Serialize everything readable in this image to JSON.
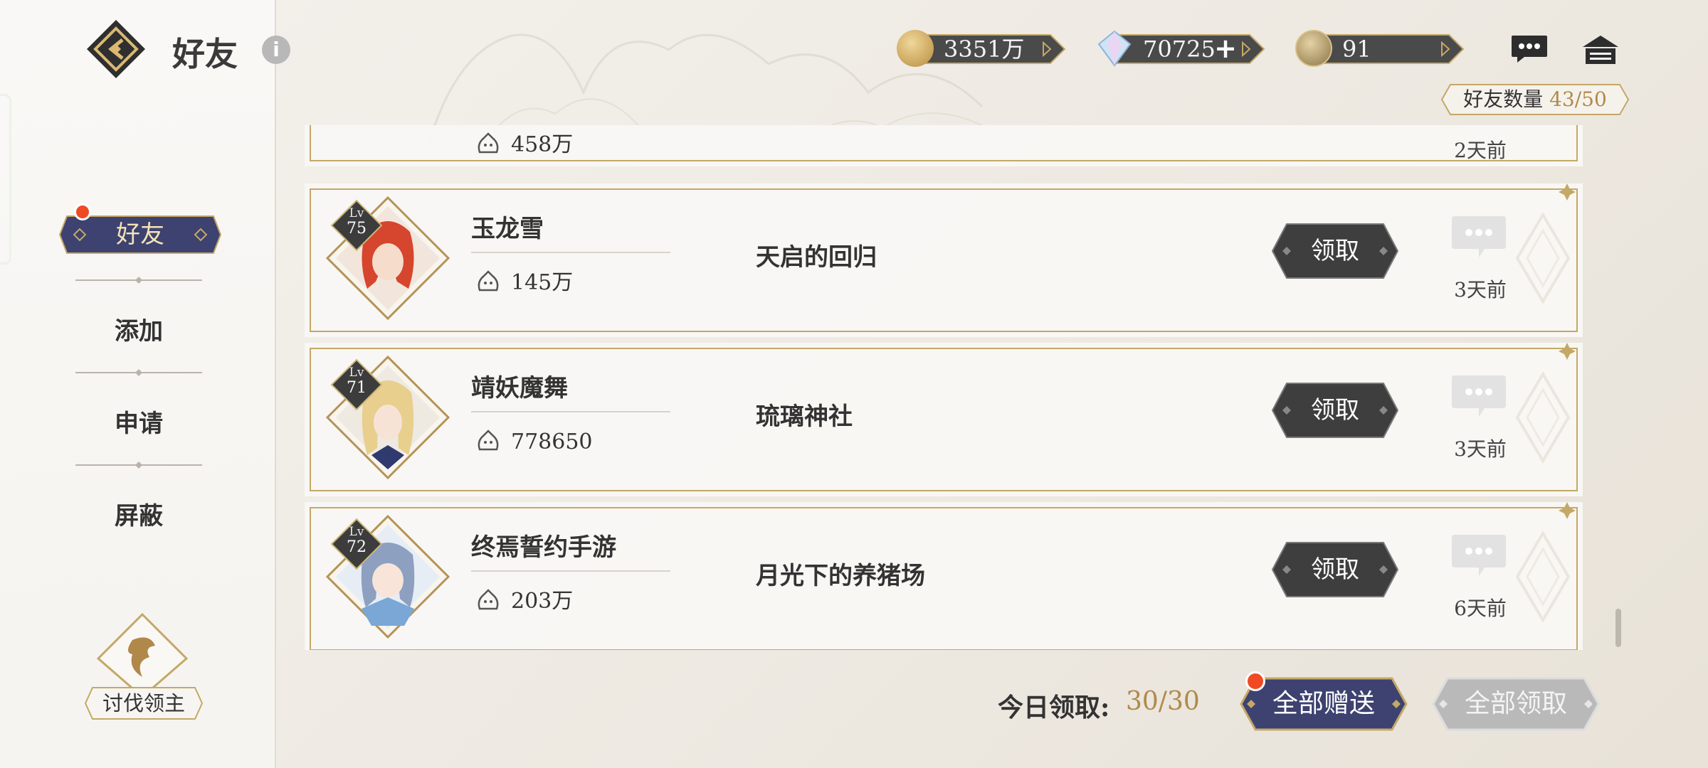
{
  "header": {
    "title": "好友",
    "info_icon": "i"
  },
  "currencies": [
    {
      "icon": "gold-coin-icon",
      "value": "3351万"
    },
    {
      "icon": "crystal-gem-icon",
      "value": "70725",
      "plus": "+"
    },
    {
      "icon": "stamina-badge-icon",
      "value": "91"
    }
  ],
  "friend_count": {
    "label": "好友数量",
    "value": "43/50"
  },
  "sidebar": {
    "items": [
      {
        "label": "好友",
        "active": true
      },
      {
        "label": "添加"
      },
      {
        "label": "申请"
      },
      {
        "label": "屏蔽"
      }
    ],
    "boss": {
      "label": "讨伐领主"
    }
  },
  "partial_row": {
    "power": "458万",
    "time": "2天前"
  },
  "friends": [
    {
      "lv_label": "Lv",
      "level": "75",
      "name": "玉龙雪",
      "power": "145万",
      "guild": "天启的回归",
      "claim": "领取",
      "time": "3天前",
      "avatar_color": "#d6452d"
    },
    {
      "lv_label": "Lv",
      "level": "71",
      "name": "靖妖魔舞",
      "power": "778650",
      "guild": "琉璃神社",
      "claim": "领取",
      "time": "3天前",
      "avatar_color": "#e8cf8e"
    },
    {
      "lv_label": "Lv",
      "level": "72",
      "name": "终焉誓约手游",
      "power": "203万",
      "guild": "月光下的养猪场",
      "claim": "领取",
      "time": "6天前",
      "avatar_color": "#7aa7d6"
    }
  ],
  "footer": {
    "today_label": "今日领取:",
    "today_value": "30/30",
    "gift_all": "全部赠送",
    "claim_all": "全部领取"
  },
  "colors": {
    "gold": "#b08a4a",
    "navy": "#3d4270",
    "dark_button": "#3e3e3e",
    "notify_red": "#ef4a24"
  }
}
